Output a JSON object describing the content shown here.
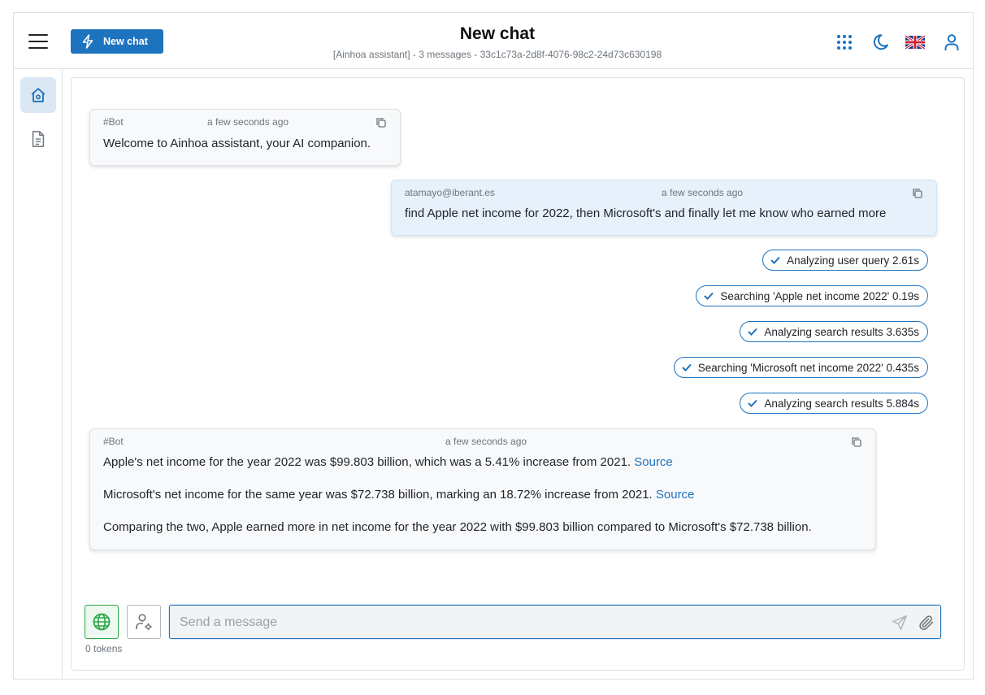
{
  "header": {
    "new_chat_label": "New chat",
    "title": "New chat",
    "subtitle": "[Ainhoa assistant] - 3 messages - 33c1c73a-2d8f-4076-98c2-24d73c630198"
  },
  "messages": [
    {
      "author": "#Bot",
      "time": "a few seconds ago",
      "paragraphs": [
        {
          "text": "Welcome to Ainhoa assistant, your AI companion.",
          "link": ""
        }
      ]
    },
    {
      "author": "atamayo@iberant.es",
      "time": "a few seconds ago",
      "paragraphs": [
        {
          "text": "find Apple net income for 2022, then Microsoft's and finally let me know who earned more",
          "link": ""
        }
      ]
    },
    {
      "author": "#Bot",
      "time": "a few seconds ago",
      "paragraphs": [
        {
          "text": "Apple's net income for the year 2022 was $99.803 billion, which was a 5.41% increase from 2021. ",
          "link": "Source"
        },
        {
          "text": "Microsoft's net income for the same year was $72.738 billion, marking an 18.72% increase from 2021. ",
          "link": "Source"
        },
        {
          "text": "Comparing the two, Apple earned more in net income for the year 2022 with $99.803 billion compared to Microsoft's $72.738 billion.",
          "link": ""
        }
      ]
    }
  ],
  "steps": [
    {
      "label": "Analyzing user query 2.61s"
    },
    {
      "label": "Searching 'Apple net income 2022' 0.19s"
    },
    {
      "label": "Analyzing search results 3.635s"
    },
    {
      "label": "Searching 'Microsoft net income 2022' 0.435s"
    },
    {
      "label": "Analyzing search results 5.884s"
    }
  ],
  "composer": {
    "placeholder": "Send a message",
    "value": "",
    "tokens": "0 tokens"
  },
  "colors": {
    "accent": "#1e73be",
    "globe_green": "#28a745"
  },
  "icons": {
    "new_chat": "bolt-icon",
    "apps": "grid-dots-icon",
    "theme": "moon-icon",
    "language": "uk-flag-icon",
    "user": "user-icon",
    "home": "home-icon",
    "documents": "document-icon",
    "copy": "copy-icon",
    "check": "check-icon",
    "globe": "globe-icon",
    "user_settings": "user-settings-icon",
    "send": "send-icon",
    "attach": "paperclip-icon"
  }
}
